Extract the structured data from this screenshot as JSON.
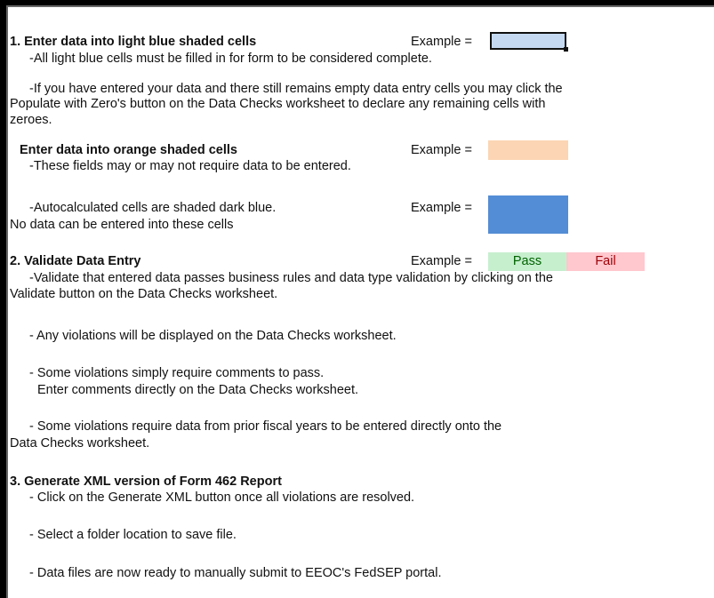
{
  "step1": {
    "heading": "1. Enter data into light blue shaded cells",
    "example_label": "Example =",
    "line1": "-All light blue cells must be filled in for form to be considered complete.",
    "para_line1": "-If you have entered your data and there still remains empty data entry cells you may click the",
    "para_line2": "Populate with Zero's button on the Data Checks worksheet to declare any remaining cells with",
    "para_line3": "zeroes."
  },
  "orange": {
    "heading": "Enter data into orange shaded cells",
    "example_label": "Example =",
    "line1": "-These fields may or may not require data to be entered."
  },
  "auto": {
    "line1": "-Autocalculated cells are shaded dark blue.",
    "example_label": "Example =",
    "line2": "No data can be entered into these cells"
  },
  "step2": {
    "heading": "2. Validate Data Entry",
    "example_label": "Example =",
    "pass_label": "Pass",
    "fail_label": "Fail",
    "line1": "-Validate that entered data passes business rules and data type validation by clicking on the",
    "line2": "Validate button on the Data Checks worksheet.",
    "line3": "- Any violations will be displayed on the Data Checks worksheet.",
    "line4": "- Some violations simply require comments to pass.",
    "line5": "Enter comments directly on the Data Checks worksheet.",
    "line6": "- Some violations require data from prior fiscal years to be entered directly onto the",
    "line7": "Data Checks worksheet."
  },
  "step3": {
    "heading": "3. Generate XML version of Form 462 Report",
    "line1": "- Click on the Generate XML button once all violations are resolved.",
    "line2": "- Select a folder location to save file.",
    "line3": "- Data files are now ready to manually submit to EEOC's FedSEP portal."
  },
  "colors": {
    "light_blue": "#c5d9f1",
    "orange": "#fcd5b4",
    "dark_blue": "#538dd5",
    "pass_bg": "#c6efce",
    "fail_bg": "#ffc7ce"
  }
}
